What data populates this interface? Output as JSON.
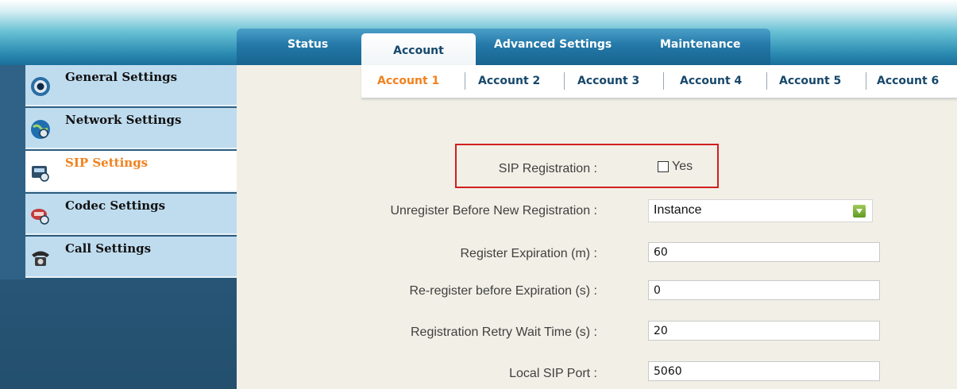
{
  "main_tabs": [
    {
      "label": "Status",
      "active": false
    },
    {
      "label": "Account",
      "active": true
    },
    {
      "label": "Advanced Settings",
      "active": false
    },
    {
      "label": "Maintenance",
      "active": false
    }
  ],
  "sub_tabs": [
    {
      "label": "Account 1",
      "active": true
    },
    {
      "label": "Account 2",
      "active": false
    },
    {
      "label": "Account 3",
      "active": false
    },
    {
      "label": "Account 4",
      "active": false
    },
    {
      "label": "Account 5",
      "active": false
    },
    {
      "label": "Account 6",
      "active": false
    }
  ],
  "sidebar": {
    "items": [
      {
        "label": "General Settings",
        "icon": "gear-icon",
        "active": false
      },
      {
        "label": "Network Settings",
        "icon": "globe-icon",
        "active": false
      },
      {
        "label": "SIP Settings",
        "icon": "sip-phone-icon",
        "active": true
      },
      {
        "label": "Codec Settings",
        "icon": "codec-icon",
        "active": false
      },
      {
        "label": "Call Settings",
        "icon": "phone-icon",
        "active": false
      }
    ]
  },
  "form": {
    "sip_registration": {
      "label": "SIP Registration :",
      "checkbox_label": "Yes",
      "checked": false
    },
    "unregister": {
      "label": "Unregister Before New Registration :",
      "value": "Instance"
    },
    "register_expiration": {
      "label": "Register Expiration (m) :",
      "value": "60"
    },
    "reregister": {
      "label": "Re-register before Expiration (s) :",
      "value": "0"
    },
    "retry_wait": {
      "label": "Registration Retry Wait Time (s) :",
      "value": "20"
    },
    "local_sip_port": {
      "label": "Local SIP Port :",
      "value": "5060"
    }
  },
  "colors": {
    "accent_orange": "#f0821e",
    "nav_blue": "#17486b",
    "highlight_red": "#d11f1f"
  }
}
